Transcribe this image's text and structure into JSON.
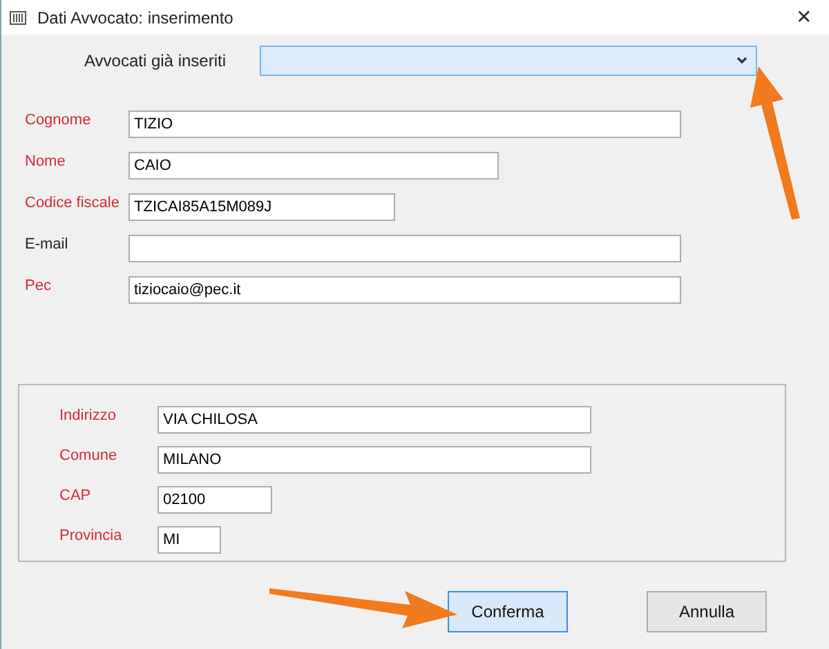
{
  "window": {
    "title": "Dati Avvocato: inserimento",
    "close": "✕"
  },
  "lookup": {
    "label": "Avvocati già inseriti",
    "expanded": false
  },
  "fields": [
    {
      "label": "Cognome",
      "value": "TIZIO",
      "required": true,
      "kind": "wide"
    },
    {
      "label": "Nome",
      "value": "CAIO",
      "required": true,
      "kind": "medium"
    },
    {
      "label": "Codice fiscale",
      "value": "TZICAI85A15M089J",
      "required": true,
      "kind": "short"
    },
    {
      "label": "E-mail",
      "required": false,
      "kind": "wide"
    },
    {
      "label": "Pec",
      "value": "tiziocaio@pec.it",
      "required": true,
      "kind": "wide"
    }
  ],
  "address": [
    {
      "label": "Indirizzo",
      "value": "VIA CHILOSA",
      "required": true,
      "kind": "wide"
    },
    {
      "label": "Comune",
      "value": "MILANO",
      "required": true,
      "kind": "wide"
    },
    {
      "label": "CAP",
      "value": "02100",
      "required": true,
      "kind": "short"
    },
    {
      "label": "Provincia",
      "value": "MI",
      "required": true,
      "kind": "tiny"
    }
  ],
  "buttons": [
    {
      "label": "Conferma",
      "focused": true
    },
    {
      "label": "Annulla",
      "focused": false
    }
  ]
}
